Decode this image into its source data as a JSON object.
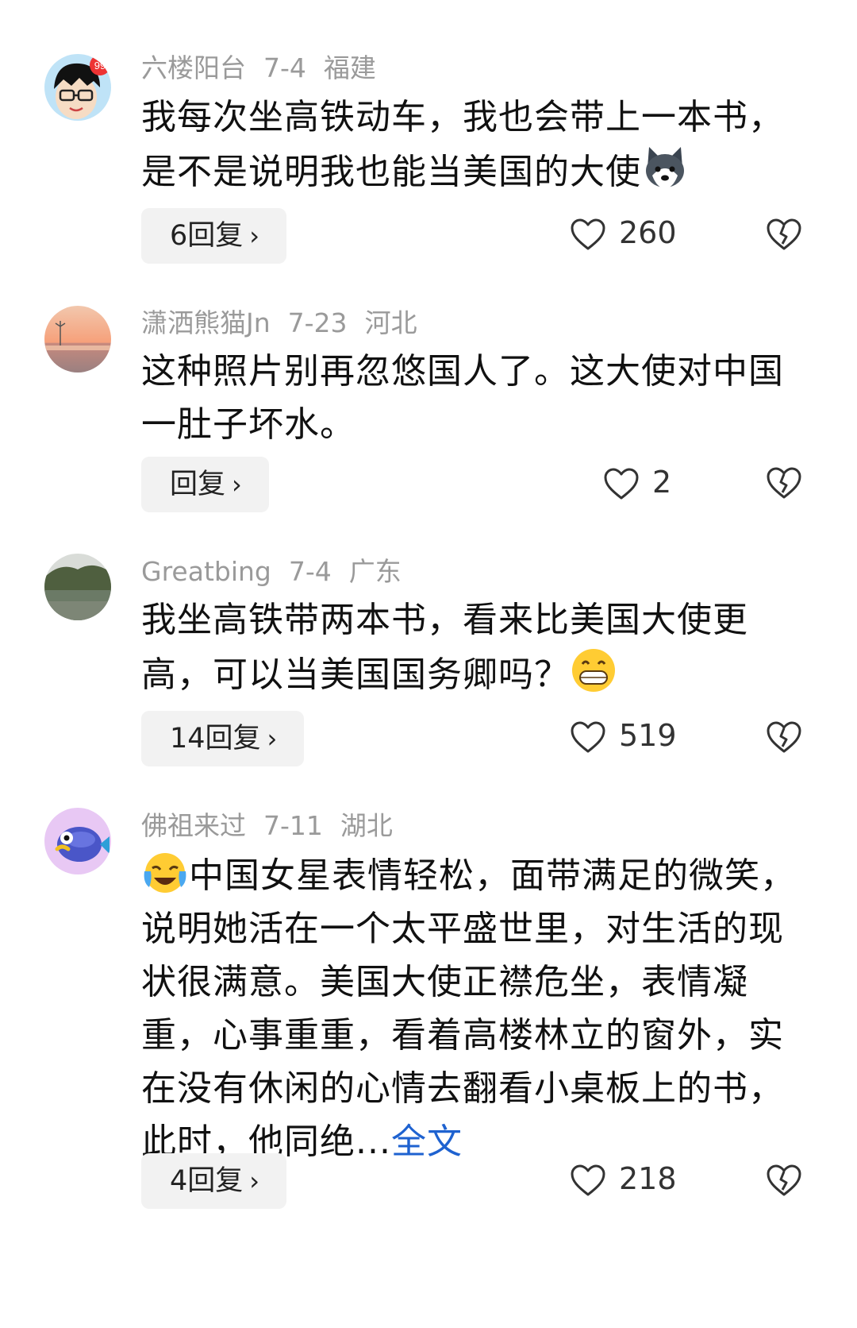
{
  "comments": [
    {
      "username": "六楼阳台",
      "date": "7-4",
      "location": "福建",
      "text": "我每次坐高铁动车，我也会带上一本书，是不是说明我也能当美国的大使",
      "reply_label": "6回复",
      "likes": "260"
    },
    {
      "username": "潇洒熊猫Jn",
      "date": "7-23",
      "location": "河北",
      "text": "这种照片别再忽悠国人了。这大使对中国一肚子坏水。",
      "reply_label": "回复",
      "likes": "2"
    },
    {
      "username": "Greatbing",
      "date": "7-4",
      "location": "广东",
      "text": "我坐高铁带两本书，看来比美国大使更高，可以当美国国务卿吗？",
      "reply_label": "14回复",
      "likes": "519"
    },
    {
      "username": "佛祖来过",
      "date": "7-11",
      "location": "湖北",
      "text": "中国女星表情轻松，面带满足的微笑，说明她活在一个太平盛世里，对生活的现状很满意。美国大使正襟危坐，表情凝重，心事重重，看着高楼林立的窗外，实在没有休闲的心情去翻看小桌板上的书，此时，他同绝...",
      "more_label": "全文",
      "reply_label": "4回复",
      "likes": "218"
    }
  ],
  "avatar_badge": "99",
  "chevron": "›",
  "icons": {
    "like": "heart-outline-icon",
    "dislike": "broken-heart-icon",
    "emoji_1": "husky-dog-emoji",
    "emoji_2": "grinning-face-emoji",
    "emoji_3": "crying-laughing-emoji"
  },
  "colors": {
    "meta": "#9a9a9a",
    "link": "#1e62d0",
    "button_bg": "#f2f2f2"
  }
}
